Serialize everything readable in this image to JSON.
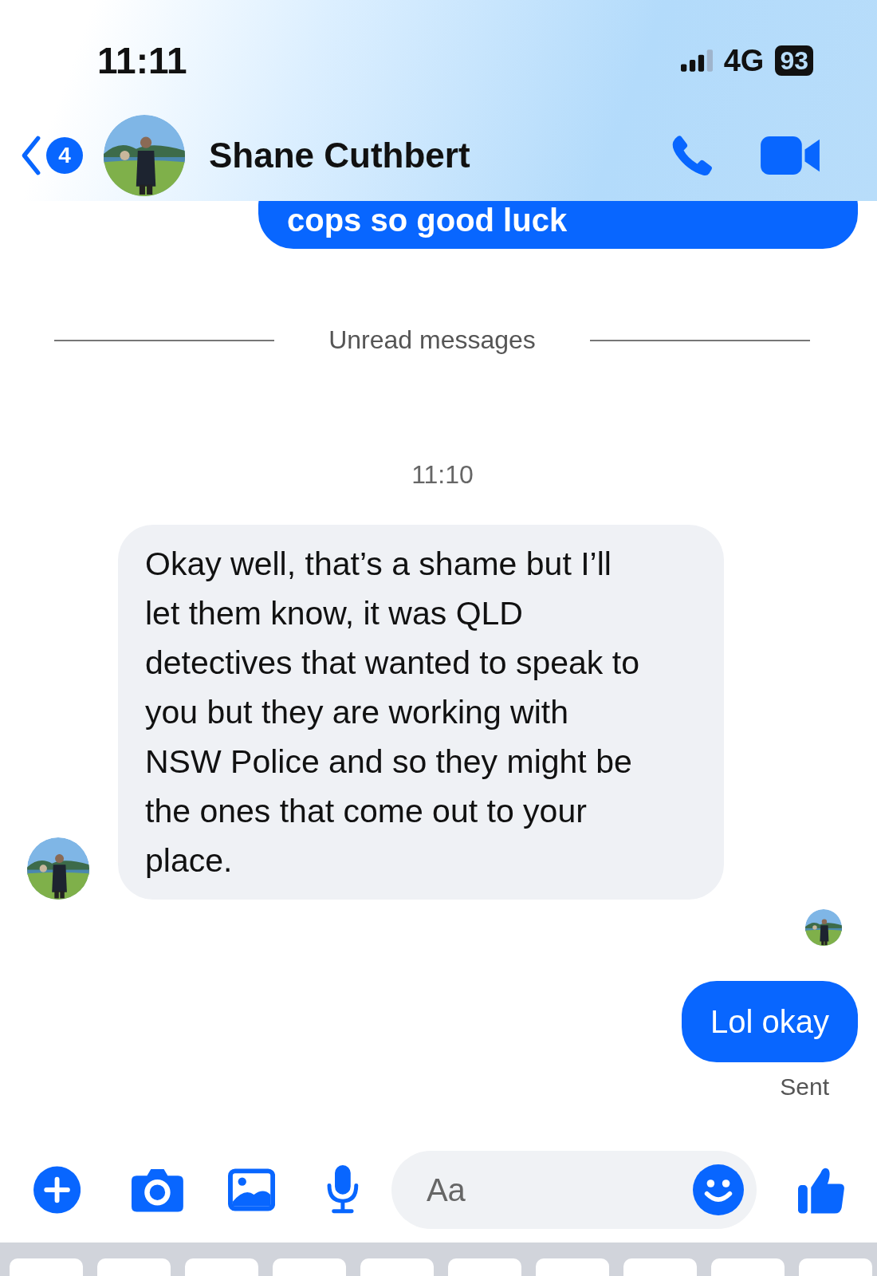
{
  "status_bar": {
    "time": "11:11",
    "network": "4G",
    "battery": "93"
  },
  "header": {
    "unread_count": "4",
    "contact_name": "Shane Cuthbert"
  },
  "messages": [
    {
      "kind": "outgoing",
      "text": "cops so good luck"
    },
    {
      "kind": "divider",
      "text": "Unread messages"
    },
    {
      "kind": "timestamp",
      "text": "11:10"
    },
    {
      "kind": "incoming",
      "text": "Okay well, that’s a shame but I’ll let them know, it was QLD detectives that wanted to speak to you but they are working with NSW Police and so they might be the ones that come out to your place."
    },
    {
      "kind": "read_receipt"
    },
    {
      "kind": "outgoing",
      "text": "Lol okay"
    },
    {
      "kind": "status",
      "text": "Sent"
    }
  ],
  "composer": {
    "placeholder": "Aa"
  }
}
